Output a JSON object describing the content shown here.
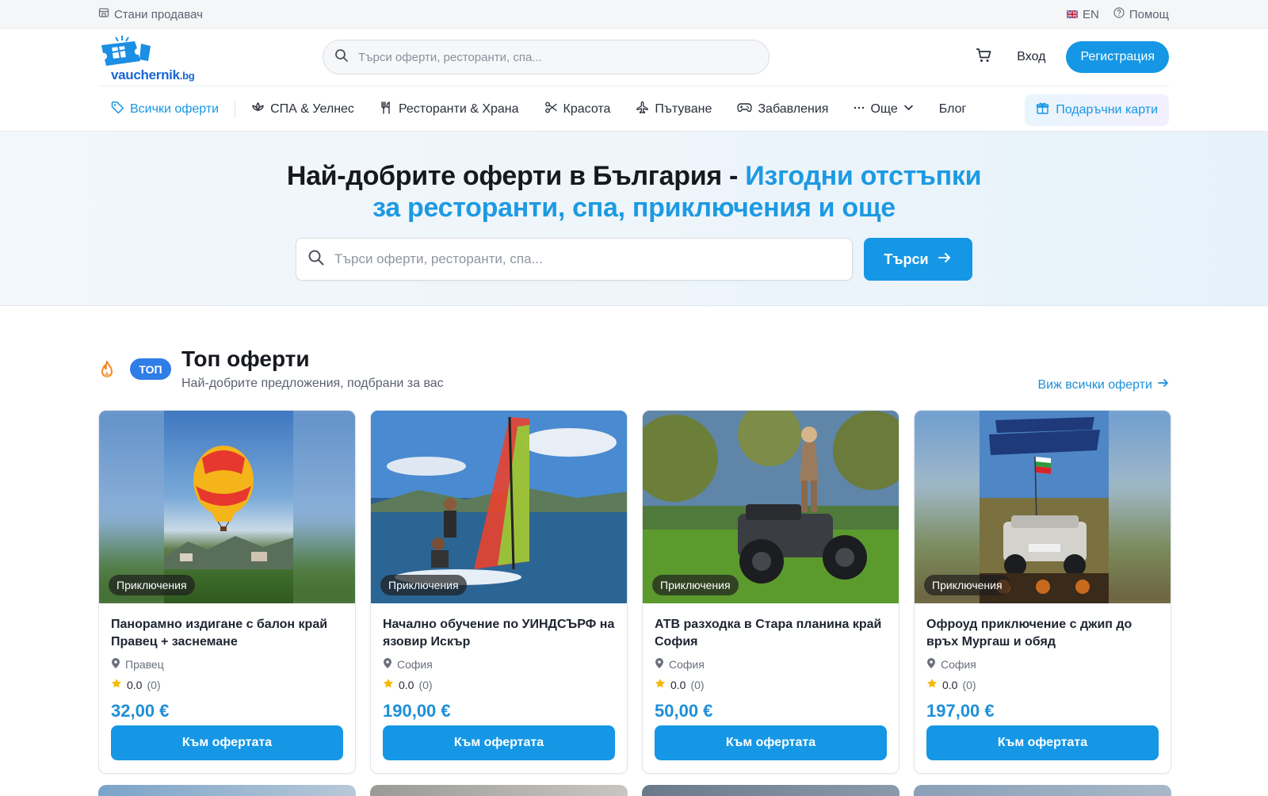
{
  "topbar": {
    "become_seller": "Стани продавач",
    "lang": "EN",
    "help": "Помощ"
  },
  "header": {
    "logo_text": "vauchernik",
    "logo_tld": ".bg",
    "search_placeholder": "Търси оферти, ресторанти, спа...",
    "login": "Вход",
    "register": "Регистрация"
  },
  "nav": {
    "items": [
      {
        "label": "Всички оферти",
        "icon": "tag-icon"
      },
      {
        "label": "СПА & Уелнес",
        "icon": "lotus-icon"
      },
      {
        "label": "Ресторанти & Храна",
        "icon": "utensils-icon"
      },
      {
        "label": "Красота",
        "icon": "scissors-icon"
      },
      {
        "label": "Пътуване",
        "icon": "plane-icon"
      },
      {
        "label": "Забавления",
        "icon": "gamepad-icon"
      },
      {
        "label": "Още",
        "icon": "more-icon"
      },
      {
        "label": "Блог"
      }
    ],
    "gift_cards": "Подаръчни карти"
  },
  "hero": {
    "title_plain": "Най-добрите оферти в България - ",
    "title_highlight_1": "Изгодни отстъпки",
    "title_highlight_2": "за ресторанти, спа, приключения и още",
    "search_placeholder": "Търси оферти, ресторанти, спа...",
    "search_button": "Търси"
  },
  "top_offers": {
    "badge": "ТОП",
    "title": "Топ оферти",
    "subtitle": "Най-добрите предложения, подбрани за вас",
    "see_all": "Виж всички оферти"
  },
  "cards": [
    {
      "category": "Приключения",
      "title": "Панорамно издигане с балон край Правец + заснемане",
      "location": "Правец",
      "rating": "0.0",
      "reviews": "(0)",
      "price": "32,00 €",
      "button": "Към офертата"
    },
    {
      "category": "Приключения",
      "title": "Начално обучение по УИНДСЪРФ на язовир Искър",
      "location": "София",
      "rating": "0.0",
      "reviews": "(0)",
      "price": "190,00 €",
      "button": "Към офертата"
    },
    {
      "category": "Приключения",
      "title": "АТВ разходка в Стара планина край София",
      "location": "София",
      "rating": "0.0",
      "reviews": "(0)",
      "price": "50,00 €",
      "button": "Към офертата"
    },
    {
      "category": "Приключения",
      "title": "Офроуд приключение с джип до връх Мургаш и обяд",
      "location": "София",
      "rating": "0.0",
      "reviews": "(0)",
      "price": "197,00 €",
      "button": "Към офертата"
    }
  ],
  "colors": {
    "accent": "#1597e5",
    "highlight": "#1d9ae2",
    "badge_blue": "#2f7de6",
    "flame": "#f08a24"
  }
}
